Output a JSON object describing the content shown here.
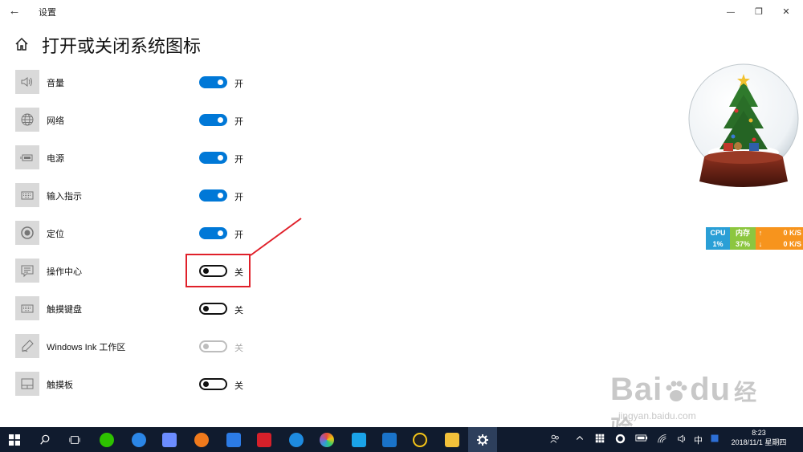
{
  "window": {
    "app_title": "设置",
    "back_glyph": "←",
    "minimize_glyph": "—",
    "restore_glyph": "❐",
    "close_glyph": "✕"
  },
  "page": {
    "title": "打开或关闭系统图标"
  },
  "items": [
    {
      "label": "音量",
      "icon": "volume-icon",
      "state": "开",
      "on": true
    },
    {
      "label": "网络",
      "icon": "globe-icon",
      "state": "开",
      "on": true
    },
    {
      "label": "电源",
      "icon": "battery-icon",
      "state": "开",
      "on": true
    },
    {
      "label": "输入指示",
      "icon": "keyboard-icon",
      "state": "开",
      "on": true
    },
    {
      "label": "定位",
      "icon": "location-icon",
      "state": "开",
      "on": true
    },
    {
      "label": "操作中心",
      "icon": "action-center-icon",
      "state": "关",
      "on": false
    },
    {
      "label": "触摸键盘",
      "icon": "keyboard-icon",
      "state": "关",
      "on": false
    },
    {
      "label": "Windows Ink 工作区",
      "icon": "pen-icon",
      "state": "关",
      "on": false,
      "disabled": true
    },
    {
      "label": "触摸板",
      "icon": "touchpad-icon",
      "state": "关",
      "on": false
    }
  ],
  "perf_widget": {
    "cpu_label": "CPU",
    "cpu_value": "1%",
    "mem_label": "内存",
    "mem_value": "37%",
    "up_arrow": "↑",
    "down_arrow": "↓",
    "up_speed": "0 K/S",
    "down_speed": "0 K/S",
    "colors": {
      "cpu": "#2a9fd6",
      "mem": "#8cc63f",
      "net": "#f7941d"
    }
  },
  "taskbar": {
    "ime": "中",
    "time": "8:23",
    "date": "2018/11/1 星期四"
  },
  "watermark": {
    "brand": "Bai",
    "brand2": "du",
    "cn": "经验",
    "url": "jingyan.baidu.com"
  },
  "colors": {
    "accent": "#0078d7",
    "highlight": "#e0202a",
    "taskbar": "#101b2e"
  }
}
